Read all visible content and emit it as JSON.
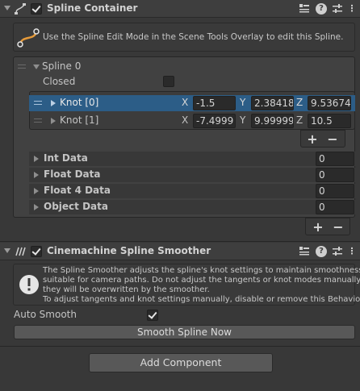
{
  "spline_container": {
    "title": "Spline Container",
    "enabled": true,
    "info": "Use the Spline Edit Mode in the Scene Tools Overlay to edit this Spline.",
    "spline": {
      "label": "Spline 0",
      "closed_label": "Closed",
      "closed": false,
      "knots": [
        {
          "label": "Knot [0]",
          "x": "-1.5",
          "y": "2.38418",
          "z": "9.53674",
          "selected": true
        },
        {
          "label": "Knot [1]",
          "x": "-7.4999",
          "y": "9.99999",
          "z": "10.5",
          "selected": false
        }
      ],
      "axis_x": "X",
      "axis_y": "Y",
      "axis_z": "Z",
      "add": "+",
      "remove": "−"
    },
    "data_lists": [
      {
        "label": "Int Data",
        "value": "0"
      },
      {
        "label": "Float Data",
        "value": "0"
      },
      {
        "label": "Float 4 Data",
        "value": "0"
      },
      {
        "label": "Object Data",
        "value": "0"
      }
    ],
    "add": "+",
    "remove": "−"
  },
  "smoother": {
    "title": "Cinemachine Spline Smoother",
    "enabled": true,
    "info_line1": "The Spline Smoother adjusts the spline's knot settings to maintain smoothness",
    "info_line2": "suitable for camera paths.  Do not adjust the tangents or knot modes manually;",
    "info_line3": "they will be overwritten by the smoother.",
    "info_line4": "To adjust tangents and knot settings manually, disable or remove this Behaviour.",
    "auto_smooth_label": "Auto Smooth",
    "auto_smooth": true,
    "smooth_button": "Smooth Spline Now"
  },
  "add_component": "Add Component",
  "icons": {
    "header_preset": "preset-icon",
    "header_help": "?",
    "header_settings": "sliders-icon",
    "header_menu": "⋮"
  }
}
